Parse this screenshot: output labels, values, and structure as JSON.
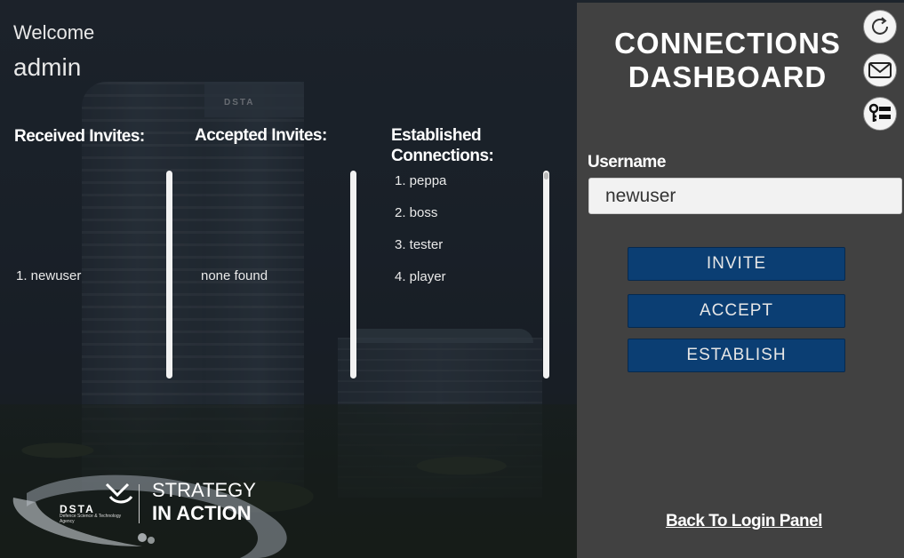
{
  "welcome": {
    "greeting": "Welcome",
    "username": "admin"
  },
  "columns": {
    "received": {
      "heading": "Received Invites:",
      "items": [
        "1. newuser"
      ]
    },
    "accepted": {
      "heading": "Accepted Invites:",
      "items": [
        "none found"
      ]
    },
    "established": {
      "heading_line1": "Established",
      "heading_line2": "Connections:",
      "items": [
        "1. peppa",
        "2. boss",
        "3. tester",
        "4. player"
      ]
    }
  },
  "background": {
    "building_sign": "DSTA"
  },
  "logo": {
    "brand": "DSTA",
    "subtitle": "Defence Science & Technology Agency",
    "tagline_line1": "STRATEGY",
    "tagline_line2": "IN ACTION"
  },
  "panel": {
    "title_line1": "CONNECTIONS",
    "title_line2": "DASHBOARD",
    "icons": [
      "refresh-icon",
      "mail-icon",
      "key-list-icon"
    ],
    "username_label": "Username",
    "username_value": "newuser",
    "buttons": {
      "invite": "INVITE",
      "accept": "ACCEPT",
      "establish": "ESTABLISH"
    },
    "back_link": "Back To Login Panel"
  },
  "colors": {
    "panel_bg": "#414141",
    "button_bg": "#0b3e73",
    "text": "#ffffff"
  }
}
